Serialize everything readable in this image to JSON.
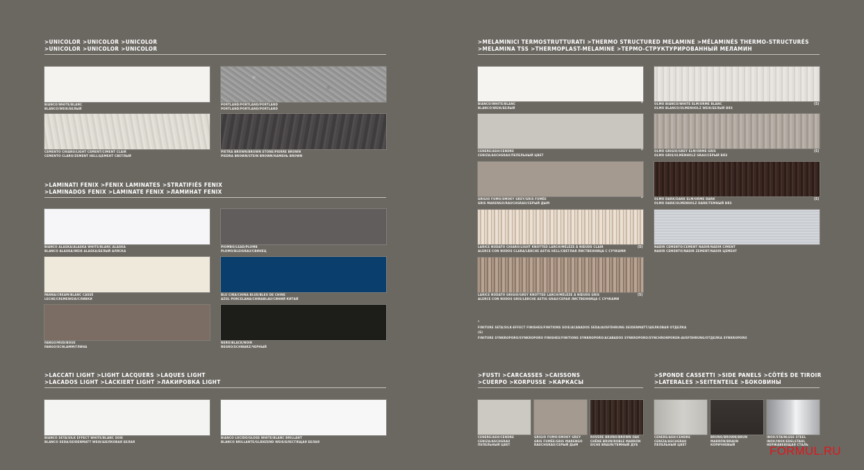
{
  "unicolor": {
    "title_line1": ">UNICOLOR >UNICOLOR >UNICOLOR",
    "title_line2": ">UNICOLOR >UNICOLOR >UNICOLOR",
    "items": [
      {
        "caption1": "BIANCO/WHITE/BLANC",
        "caption2": "BLANCO/WEIß/БЕЛЫЙ"
      },
      {
        "caption1": "PORTLAND/PORTLAND/PORTLAND",
        "caption2": "PORTLAND/PORTLAND/PORTLAND"
      },
      {
        "caption1": "CEMENTO CHIARO/LIGHT CEMENT/CIMENT CLAIR",
        "caption2": "CEMENTO CLARO/ZEMENT HELL/ЦЕМЕНТ СВЕТЛЫЙ"
      },
      {
        "caption1": "PIETRA BROWN/BROWN STONE/PIERRE BROWN",
        "caption2": "PIEDRA BROWN/STEIN BROWN/КАМЕНЬ BROWN"
      }
    ]
  },
  "fenix": {
    "title_line1": ">LAMINATI FENIX >FENIX LAMINATES >STRATIFIÉS FENIX",
    "title_line2": ">LAMINADOS FENIX >LAMINATE FENIX >ЛАМИНАТ FENIX",
    "items": [
      {
        "caption1": "BIANCO ALASKA/ALASKA WHITE/BLANC ALASKA",
        "caption2": "BLANCO ALASKA/WEIß ALASKA/БЕЛЫЙ АЛЯСКА"
      },
      {
        "caption1": "PIOMBO/LEAD/PLOMB",
        "caption2": "PLOMO/BLEIGRAU/СВИНЕЦ"
      },
      {
        "caption1": "PANNA/CREAM/BLANC CASSÉ",
        "caption2": "LECHE/CREMEWEIß/СЛИВКИ"
      },
      {
        "caption1": "BLU CINA/CHINA BLUE/BLEU DE CHINE",
        "caption2": "AZUL PORCELANA/CHINABLAU/СИНИЙ КИТАЙ"
      },
      {
        "caption1": "FANGO/MUD/BOUE",
        "caption2": "FANGO/SCHLAMM/ГЛИНА"
      },
      {
        "caption1": "NERO/BLACK/NOIR",
        "caption2": "NEGRO/SCHWARZ/ЧЕРНЫЙ"
      }
    ]
  },
  "lacquers": {
    "title_line1": ">LACCATI LIGHT >LIGHT LACQUERS >LAQUES LIGHT",
    "title_line2": ">LACADOS LIGHT >LACKIERT LIGHT >ЛАКИРОВКА LIGHT",
    "items": [
      {
        "caption1": "BIANCO SETA/SILK EFFECT WHITE/BLANC SOIE",
        "caption2": "BLANCO SEDA/SEIDENMATT WEIß/ШЕЛКОВАЯ БЕЛАЯ"
      },
      {
        "caption1": "BIANCO LUCIDO/GLOSS WHITE/BLANC BRILLANT",
        "caption2": "BLANCO BRILLANTE/GLÄNZEND WEIß/БЛЕСТЯЩАЯ БЕЛАЯ"
      }
    ]
  },
  "melamine": {
    "title_line1": ">MELAMINICI TERMOSTRUTTURATI >THERMO STRUCTURED MELAMINE >MÉLAMINÉS THERMO-STRUCTURÉS",
    "title_line2": ">MELAMINA TSS >THERMOPLAST-MELAMINE >ТЕРМО-СТРУКТУРИРОВАННЫЙ МЕЛАМИН",
    "items": [
      {
        "caption1": "BIANCO/WHITE/BLANC",
        "caption2": "BLANCO/WEIß/БЕЛЫЙ",
        "mark": "*"
      },
      {
        "caption1": "OLMO BIANCO/WHITE ELM/ORME BLANC",
        "caption2": "OLMO BLANCO/ULMENHOLZ WEIß/БЕЛЫЙ ВЯЗ",
        "mark": "(S)"
      },
      {
        "caption1": "CENERE/ASH/CENDRE",
        "caption2": "CENIZA/ASCHGRAU/ПЕПЕЛЬНЫЙ ЦВЕТ",
        "mark": "*"
      },
      {
        "caption1": "OLMO GRIGIO/GREY ELM/ORME GRIS",
        "caption2": "OLMO GRIS/ULMENHOLZ GRAU/СЕРЫЙ ВЯЗ",
        "mark": "(S)"
      },
      {
        "caption1": "GRIGIO FUMO/SMOKY GREY/GRIS FUMÉE",
        "caption2": "GRIS MARENGO/RAUCHGRAU/СЕРЫЙ ДЫМ",
        "mark": "*"
      },
      {
        "caption1": "OLMO DARK/DARK ELM/ORME DARK",
        "caption2": "OLMO DARK/ULMENHOLZ DARK/ТЕМНЫЙ ВЯЗ",
        "mark": "(S)"
      },
      {
        "caption1": "LARICE NODATO CHIARO/LIGHT KNOTTED LARCH/MÉLÈZE À NŒUDS CLAIR",
        "caption2": "ALERCE CON NUDOS CLARA/LÄRCHE ASTIG HELL/СВЕТЛАЯ ЛИСТВЕННИЦА С СУЧКАМИ",
        "mark": "(S)"
      },
      {
        "caption1": "NADIR CEMENTO/CEMENT NADIR/NADIR CIMENT",
        "caption2": "NADIR CEMENTO/NADIR ZEMENT/NADIR ЦЕМЕНТ",
        "mark": ""
      },
      {
        "caption1": "LARICE NODATO GRIGIO/GREY KNOTTED LARCH/MÉLÈZE À NŒUDS GRIS",
        "caption2": "ALERCE CON NUDOS GRIS/LÄRCHE ASTIG GRAU/СЕРАЯ ЛИСТВЕННИЦА С СУЧКАМИ",
        "mark": "(S)"
      }
    ],
    "note_star": "*",
    "note1": "FINITURE SETA/SILK-EFFECT FINISHES/FINITIONS SOIE/ACABADOS SEDA/AUSFÜHRUNG SEIDENMATT/ШЕЛКОВАЯ ОТДЕЛКА",
    "note_s": "(S)",
    "note2": "FINITURE SYNKROPORO/SYNKROPORO FINISHES/FINITIONS SYNKROPORO/ACABADOS SYNKROPORO/SYNCHRONPOREN-AUSFÜHRUNG/ОТДЕЛКА SYNKROPORO"
  },
  "carcasses": {
    "title_line1": ">FUSTI >CARCASSES >CAISSONS",
    "title_line2": ">CUERPO >KORPUSSE >КАРКАСЫ",
    "items": [
      {
        "caption1": "CENERE/ASH/CENDRE",
        "caption2": "CENIZA/ASCHGRAU",
        "caption3": "ПЕПЕЛЬНЫЙ ЦВЕТ"
      },
      {
        "caption1": "GRIGIO FUMO/SMOKY GREY",
        "caption2": "GRIS FUMÉE/GRIS MARENGO",
        "caption3": "RAUCHGRAU/СЕРЫЙ ДЫМ"
      },
      {
        "caption1": "ROVERE BRUNO/BROWN OAK",
        "caption2": "CHÊNE BRUN/ROBLE MARRÓN",
        "caption3": "EICHE BRAUN/ТЕМНЫЙ ДУБ"
      }
    ]
  },
  "sidepanels": {
    "title_line1": ">SPONDE CASSETTI >SIDE PANELS >CÔTÉS DE TIROIR",
    "title_line2": ">LATERALES >SEITENTEILE >БОКОВИНЫ",
    "items": [
      {
        "caption1": "CENERE/ASH/CENDRE",
        "caption2": "CENIZA/ASCHGRAU",
        "caption3": "ПЕПЕЛЬНЫЙ ЦВЕТ"
      },
      {
        "caption1": "BRUNO/BROWN/BRUN",
        "caption2": "MARRÓN/BRAUN",
        "caption3": "КОРИЧНЕВЫЙ"
      },
      {
        "caption1": "INOX/STAINLESS STEEL",
        "caption2": "INOX/INOX/EDELSTAHL",
        "caption3": "НЕРЖАВЕЮЩАЯ СТАЛЬ"
      }
    ]
  },
  "watermark": "FORMUL.RU"
}
